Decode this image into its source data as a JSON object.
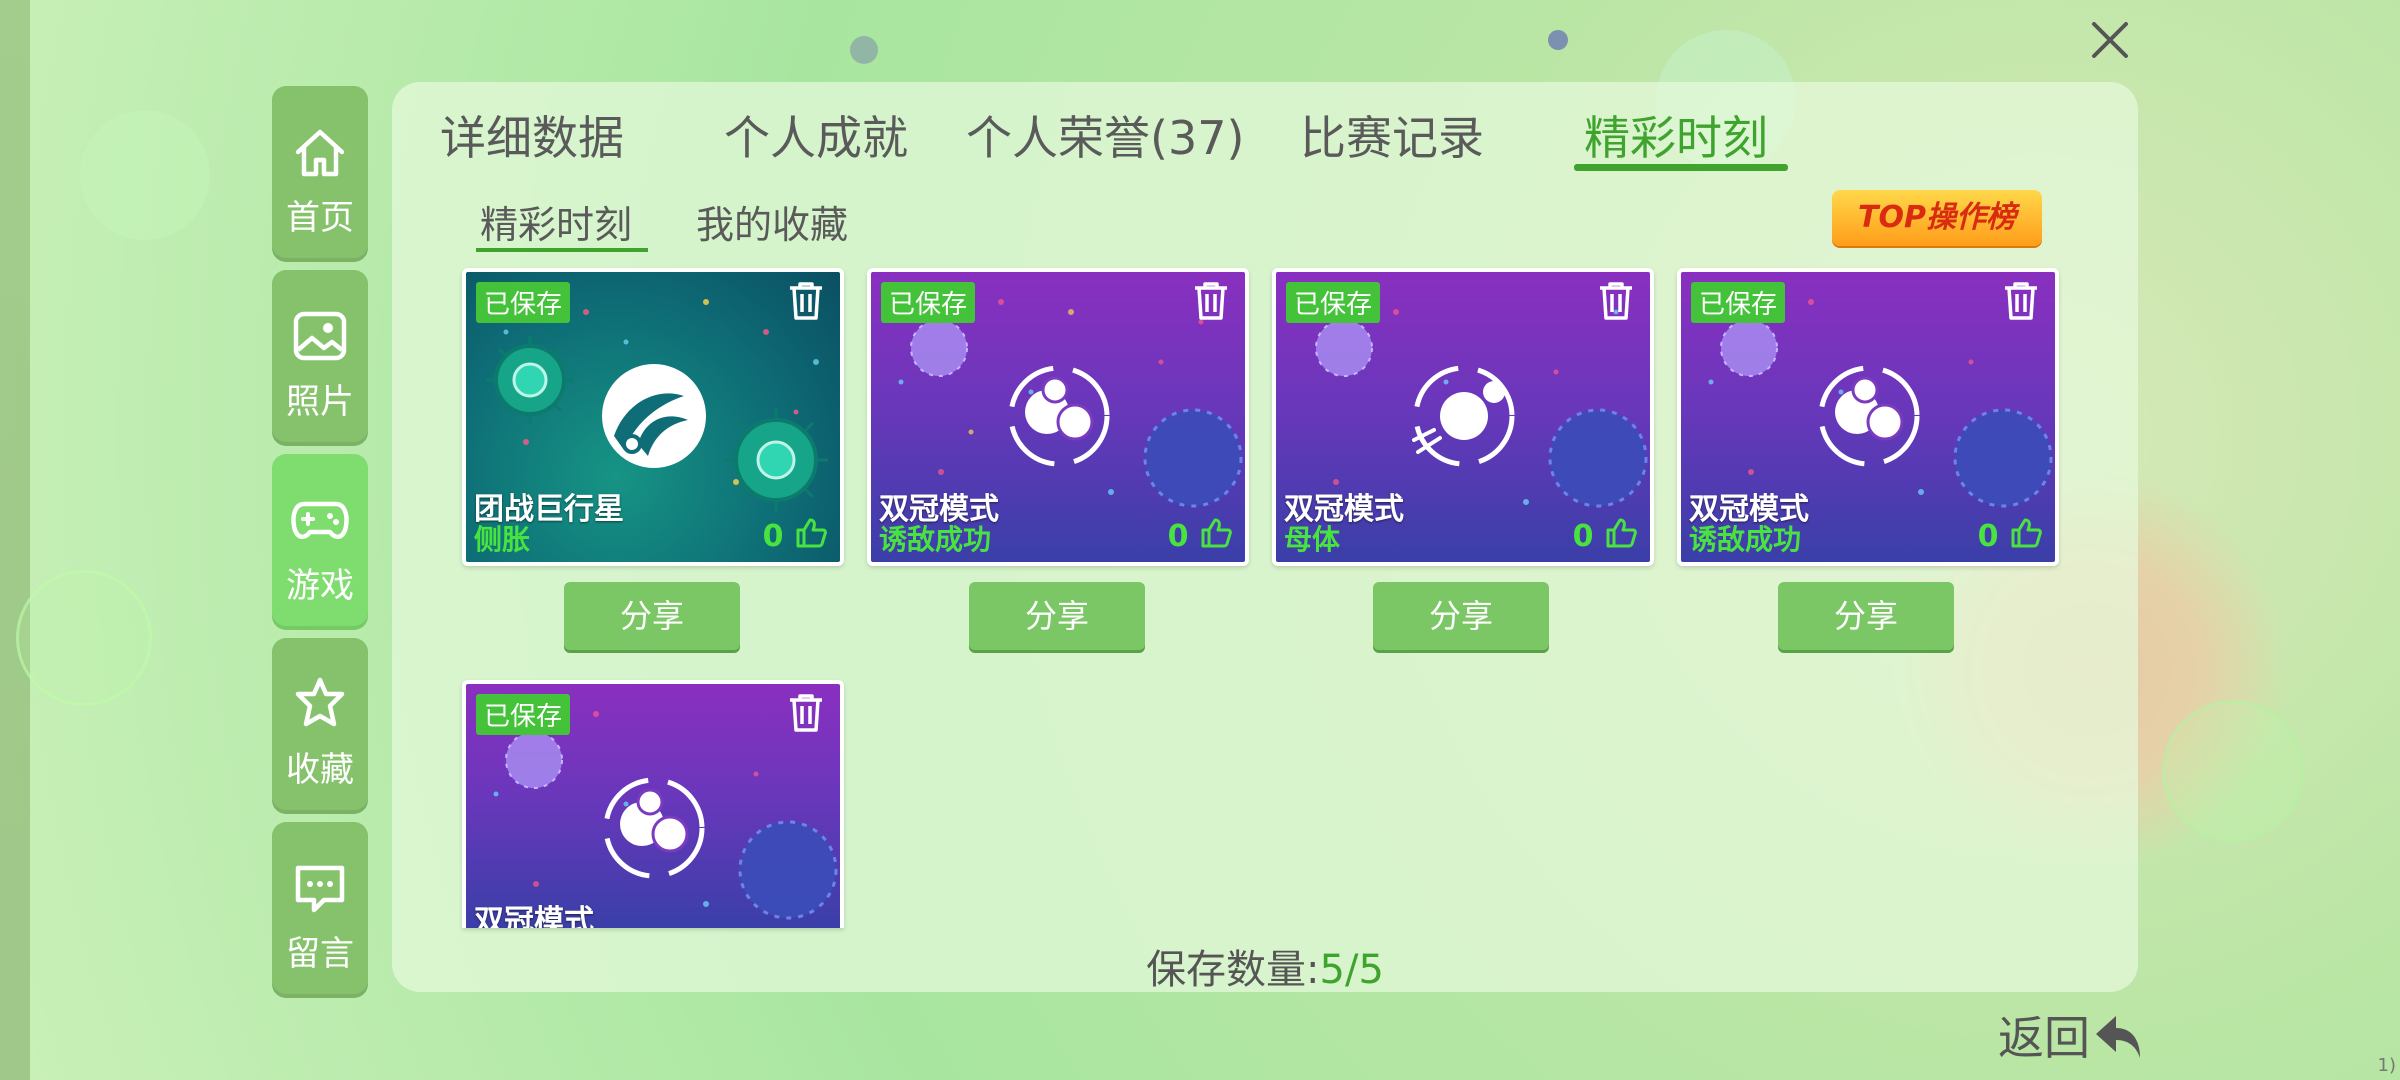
{
  "close_icon": "close-icon",
  "sidenav": [
    {
      "label": "首页",
      "icon": "home-icon"
    },
    {
      "label": "照片",
      "icon": "photo-icon"
    },
    {
      "label": "游戏",
      "icon": "gamepad-icon",
      "active": true
    },
    {
      "label": "收藏",
      "icon": "star-icon"
    },
    {
      "label": "留言",
      "icon": "message-icon"
    }
  ],
  "tabs": [
    {
      "label": "详细数据"
    },
    {
      "label": "个人成就"
    },
    {
      "label": "个人荣誉(37)"
    },
    {
      "label": "比赛记录"
    },
    {
      "label": "精彩时刻",
      "active": true
    }
  ],
  "subtabs": [
    {
      "label": "精彩时刻",
      "active": true
    },
    {
      "label": "我的收藏"
    }
  ],
  "top_badge": "TOP操作榜",
  "cards": [
    {
      "saved": "已保存",
      "mode": "团战巨行星",
      "sub": "侧胀",
      "likes": "0",
      "theme": "teal"
    },
    {
      "saved": "已保存",
      "mode": "双冠模式",
      "sub": "诱敌成功",
      "likes": "0",
      "theme": "purple"
    },
    {
      "saved": "已保存",
      "mode": "双冠模式",
      "sub": "母体",
      "likes": "0",
      "theme": "purple"
    },
    {
      "saved": "已保存",
      "mode": "双冠模式",
      "sub": "诱敌成功",
      "likes": "0",
      "theme": "purple"
    },
    {
      "saved": "已保存",
      "mode": "双冠模式",
      "theme": "purple"
    }
  ],
  "share_label": "分享",
  "save_count": {
    "label": "保存数量:",
    "value": "5/5"
  },
  "back_label": "返回",
  "corner_text": "1)",
  "colors": {
    "accent": "#3fa42e",
    "like_green": "#49e340",
    "top_badge": "#ffb020"
  }
}
